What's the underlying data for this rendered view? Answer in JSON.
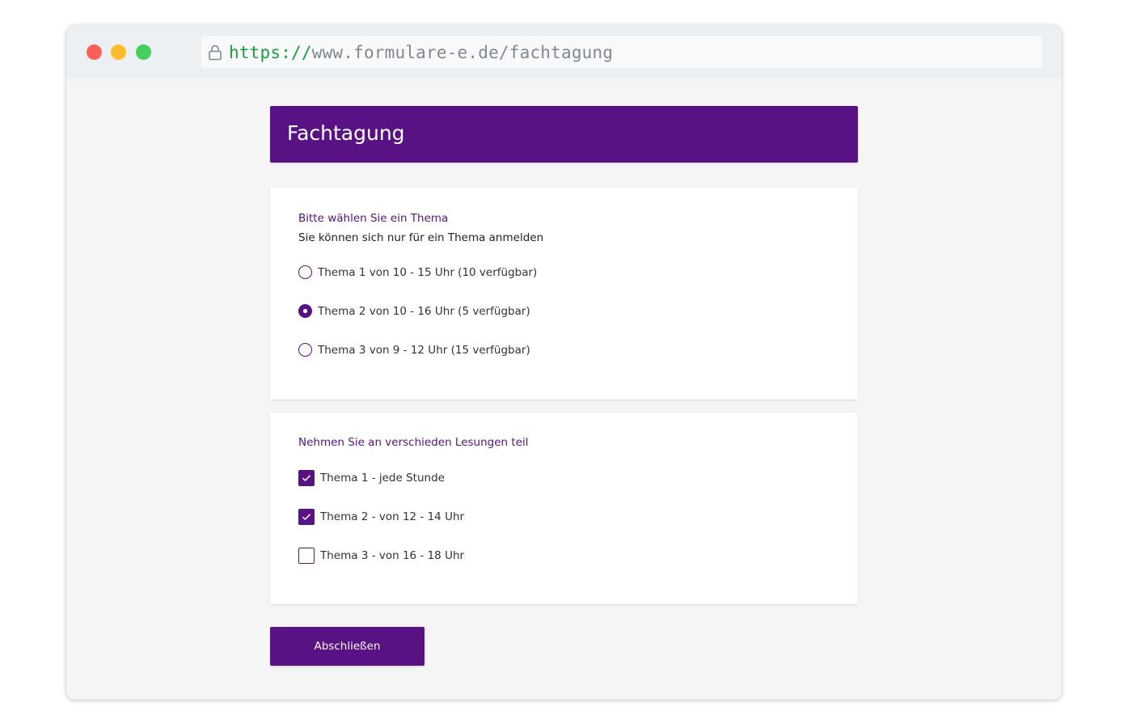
{
  "browser": {
    "url_scheme": "https://",
    "url_rest": "www.formulare-e.de/fachtagung"
  },
  "form": {
    "title": "Fachtagung",
    "topic_section": {
      "title": "Bitte wählen Sie ein Thema",
      "subtitle": "Sie können sich nur für ein Thema anmelden",
      "options": [
        {
          "label": "Thema 1 von 10 - 15 Uhr (10 verfügbar)",
          "selected": false
        },
        {
          "label": "Thema 2 von 10 - 16 Uhr (5 verfügbar)",
          "selected": true
        },
        {
          "label": "Thema 3 von 9 - 12 Uhr (15 verfügbar)",
          "selected": false
        }
      ]
    },
    "readings_section": {
      "title": "Nehmen Sie an verschieden Lesungen teil",
      "options": [
        {
          "label": "Thema 1 - jede Stunde",
          "checked": true
        },
        {
          "label": "Thema 2 - von 12 - 14 Uhr",
          "checked": true
        },
        {
          "label": "Thema 3 - von 16 - 18 Uhr",
          "checked": false
        }
      ]
    },
    "submit_label": "Abschließen"
  },
  "colors": {
    "accent": "#581283",
    "url_scheme": "#1e9e3a"
  }
}
